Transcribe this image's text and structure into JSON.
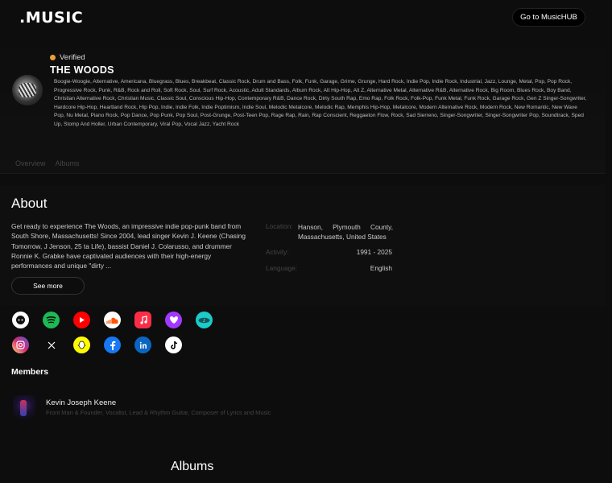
{
  "header": {
    "logo": ".MUSIC",
    "hub_button": "Go to MusicHUB"
  },
  "artist": {
    "verified_label": "Verified",
    "name": "THE WOODS",
    "genres": "Boogie-Woogie, Alternative, Americana, Bluegrass, Blues, Breakbeat, Classic Rock, Drum and Bass, Folk, Funk, Garage, Grime, Grunge, Hard Rock, Indie Pop, Indie Rock, Industrial, Jazz, Lounge, Metal, Pop, Pop Rock, Progressive Rock, Punk, R&B, Rock and Roll, Soft Rock, Soul, Surf Rock, Acoustic, Adult Standards, Album Rock, Alt Hip-Hop, Alt Z, Alternative Metal, Alternative R&B, Alternative Rock, Big Room, Blues Rock, Boy Band, Christian Alternative Rock, Christian Music, Classic Soul, Conscious Hip-Hop, Contemporary R&B, Dance Rock, Dirty South Rap, Emo Rap, Folk Rock, Folk-Pop, Funk Metal, Funk Rock, Garage Rock, Gen Z Singer-Songwriter, Hardcore Hip-Hop, Heartland Rock, Hip Pop, Indie, Indie Folk, Indie Poptimism, Indie Soul, Melodic Metalcore, Melodic Rap, Memphis Hip-Hop, Metalcore, Modern Alternative Rock, Modern Rock, New Romantic, New Wave Pop, Nu Metal, Piano Rock, Pop Dance, Pop Punk, Pop Soul, Post-Grunge, Post-Teen Pop, Rage Rap, Rain, Rap Conscient, Reggaeton Flow, Rock, Sad Sierreno, Singer-Songwriter, Singer-Songwriter Pop, Soundtrack, Sped Up, Stomp And Holler, Urban Contemporary, Viral Pop, Vocal Jazz, Yacht Rock"
  },
  "tabs": [
    "Overview",
    "Albums"
  ],
  "about": {
    "title": "About",
    "text": "Get ready to experience The Woods, an impressive indie pop-punk band from South Shore, Massachusetts! Since 2004, lead singer Kevin J. Keene (Chasing Tomorrow, J Jenson, 25 ta Life), bassist Daniel J. Colarusso, and drummer Ronnie K. Grabke have captivated audiences with their high-energy performances and unique \"dirty ...",
    "see_more": "See more",
    "info": {
      "location_label": "Location:",
      "location_value": "Hanson, Plymouth County, Massachusetts, United States",
      "activity_label": "Activity:",
      "activity_value": "1991 - 2025",
      "language_label": "Language:",
      "language_value": "English"
    }
  },
  "socials": [
    {
      "name": "musichub-icon",
      "color": "#ffffff"
    },
    {
      "name": "spotify-icon",
      "color": "#1db954"
    },
    {
      "name": "youtube-icon",
      "color": "#ff0000"
    },
    {
      "name": "soundcloud-icon",
      "color": "#ffffff"
    },
    {
      "name": "apple-music-icon",
      "color": "#fa2d48"
    },
    {
      "name": "deezer-icon",
      "color": "#a238ff"
    },
    {
      "name": "tidal-icon",
      "color": "#1ec9c9"
    },
    {
      "name": "instagram-icon",
      "color": "#d62976"
    },
    {
      "name": "x-icon",
      "color": "#000000"
    },
    {
      "name": "snapchat-icon",
      "color": "#fffc00"
    },
    {
      "name": "facebook-icon",
      "color": "#1877f2"
    },
    {
      "name": "linkedin-icon",
      "color": "#0a66c2"
    },
    {
      "name": "tiktok-icon",
      "color": "#ffffff"
    }
  ],
  "members": {
    "title": "Members",
    "items": [
      {
        "name": "Kevin Joseph Keene",
        "roles": "Front Man & Founder, Vocalist, Lead & Rhythm Guitar, Composer of Lyrics and Music"
      }
    ]
  },
  "albums": {
    "title": "Albums"
  }
}
